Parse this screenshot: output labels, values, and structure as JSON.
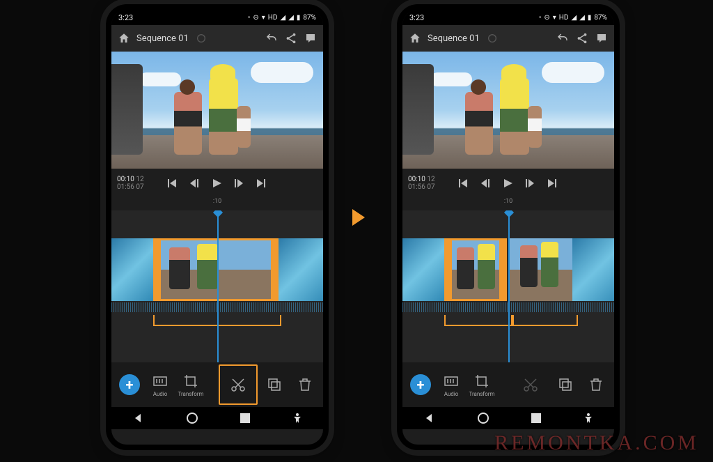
{
  "statusbar": {
    "time": "3:23",
    "hd": "HD",
    "battery": "87%"
  },
  "appbar": {
    "title": "Sequence 01"
  },
  "playback": {
    "current_time": "00:10",
    "current_frames": "12",
    "total_time": "01:56",
    "total_frames": "07"
  },
  "timeline": {
    "marker": ":10"
  },
  "tools": {
    "audio": "Audio",
    "transform": "Transform"
  },
  "watermark": "REMONTKA.COM"
}
